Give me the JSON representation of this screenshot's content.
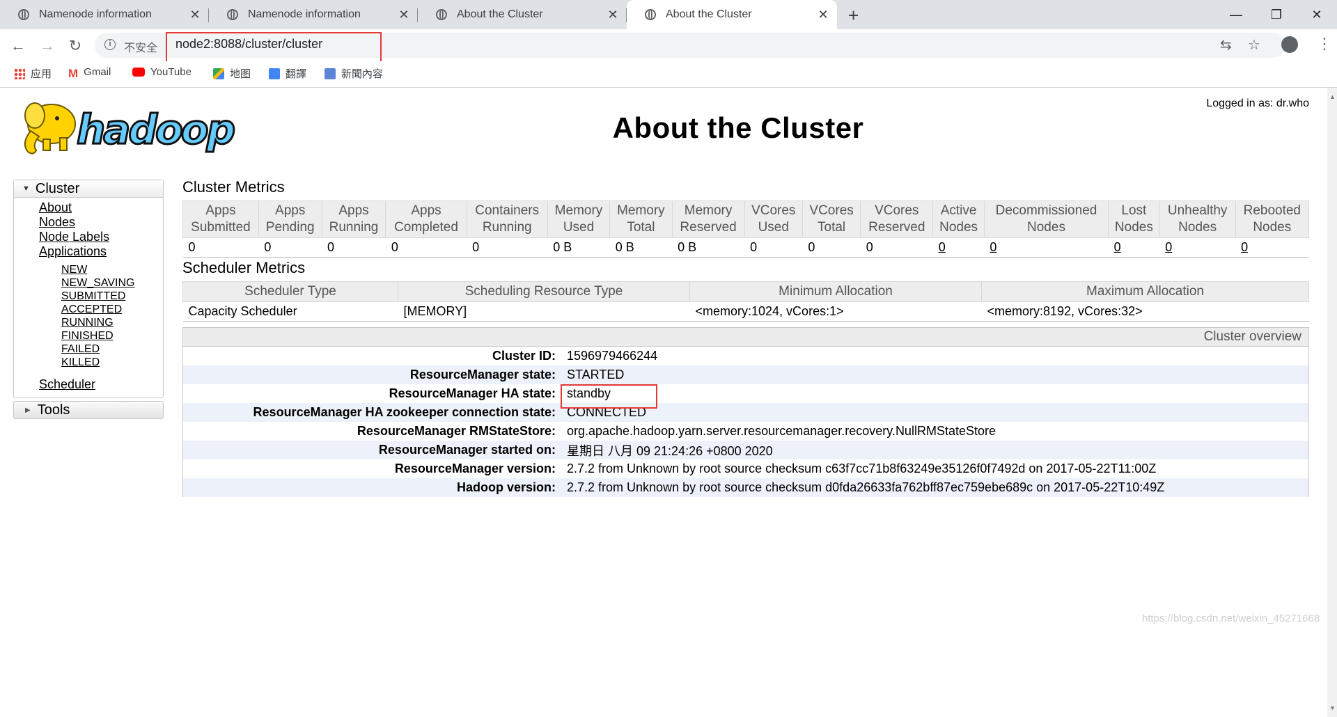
{
  "browser": {
    "tabs": [
      {
        "title": "Namenode information",
        "active": false
      },
      {
        "title": "Namenode information",
        "active": false
      },
      {
        "title": "About the Cluster",
        "active": false
      },
      {
        "title": "About the Cluster",
        "active": true
      }
    ],
    "security_label": "不安全",
    "url": "node2:8088/cluster/cluster",
    "bookmarks": [
      "应用",
      "Gmail",
      "YouTube",
      "地图",
      "翻譯",
      "新聞內容"
    ]
  },
  "page": {
    "logged_in": "Logged in as: dr.who",
    "title": "About the Cluster",
    "logo_text": "hadoop"
  },
  "sidebar": {
    "cluster_label": "Cluster",
    "links": [
      "About",
      "Nodes",
      "Node Labels",
      "Applications"
    ],
    "app_states": [
      "NEW",
      "NEW_SAVING",
      "SUBMITTED",
      "ACCEPTED",
      "RUNNING",
      "FINISHED",
      "FAILED",
      "KILLED"
    ],
    "scheduler_label": "Scheduler",
    "tools_label": "Tools"
  },
  "cluster_metrics": {
    "heading": "Cluster Metrics",
    "columns": [
      [
        "Apps",
        "Submitted"
      ],
      [
        "Apps",
        "Pending"
      ],
      [
        "Apps",
        "Running"
      ],
      [
        "Apps",
        "Completed"
      ],
      [
        "Containers",
        "Running"
      ],
      [
        "Memory",
        "Used"
      ],
      [
        "Memory",
        "Total"
      ],
      [
        "Memory",
        "Reserved"
      ],
      [
        "VCores",
        "Used"
      ],
      [
        "VCores",
        "Total"
      ],
      [
        "VCores",
        "Reserved"
      ],
      [
        "Active",
        "Nodes"
      ],
      [
        "Decommissioned",
        "Nodes"
      ],
      [
        "Lost",
        "Nodes"
      ],
      [
        "Unhealthy",
        "Nodes"
      ],
      [
        "Rebooted",
        "Nodes"
      ]
    ],
    "values": [
      "0",
      "0",
      "0",
      "0",
      "0",
      "0 B",
      "0 B",
      "0 B",
      "0",
      "0",
      "0",
      "0",
      "0",
      "0",
      "0",
      "0"
    ]
  },
  "scheduler_metrics": {
    "heading": "Scheduler Metrics",
    "columns": [
      "Scheduler Type",
      "Scheduling Resource Type",
      "Minimum Allocation",
      "Maximum Allocation"
    ],
    "row": [
      "Capacity Scheduler",
      "[MEMORY]",
      "<memory:1024, vCores:1>",
      "<memory:8192, vCores:32>"
    ]
  },
  "overview": {
    "heading": "Cluster overview",
    "rows": [
      {
        "key": "Cluster ID:",
        "value": "1596979466244"
      },
      {
        "key": "ResourceManager state:",
        "value": "STARTED"
      },
      {
        "key": "ResourceManager HA state:",
        "value": "standby"
      },
      {
        "key": "ResourceManager HA zookeeper connection state:",
        "value": "CONNECTED"
      },
      {
        "key": "ResourceManager RMStateStore:",
        "value": "org.apache.hadoop.yarn.server.resourcemanager.recovery.NullRMStateStore"
      },
      {
        "key": "ResourceManager started on:",
        "value": "星期日 八月 09 21:24:26 +0800 2020"
      },
      {
        "key": "ResourceManager version:",
        "value": "2.7.2 from Unknown by root source checksum c63f7cc71b8f63249e35126f0f7492d on 2017-05-22T11:00Z"
      },
      {
        "key": "Hadoop version:",
        "value": "2.7.2 from Unknown by root source checksum d0fda26633fa762bff87ec759ebe689c on 2017-05-22T10:49Z"
      }
    ]
  },
  "watermark": "https://blog.csdn.net/weixin_45271668",
  "colors": {
    "highlight": "#e53935",
    "logo_yellow": "#ffd200",
    "logo_blue": "#66ccff"
  }
}
